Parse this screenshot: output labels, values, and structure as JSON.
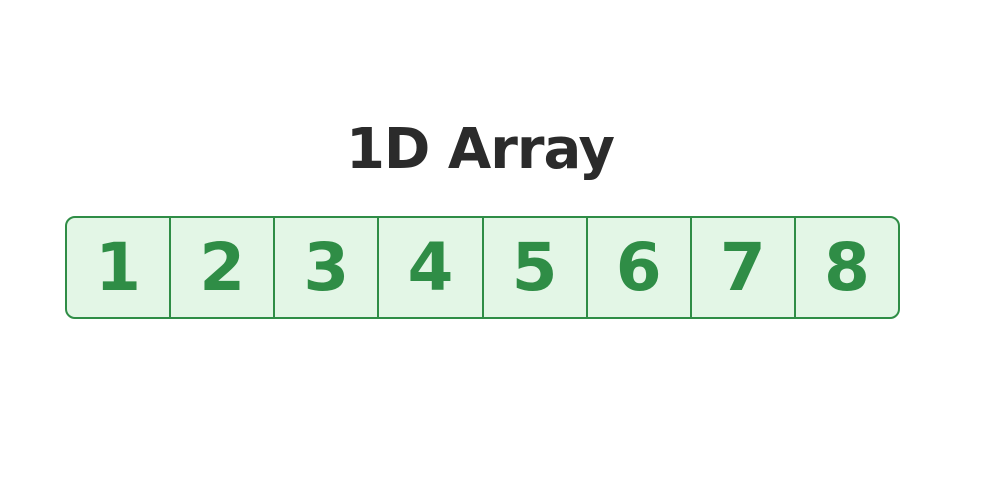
{
  "title": "1D Array",
  "array": {
    "cells": [
      "1",
      "2",
      "3",
      "4",
      "5",
      "6",
      "7",
      "8"
    ]
  },
  "colors": {
    "title_text": "#2b2b2b",
    "cell_text": "#2f8d46",
    "cell_border": "#2f8d46",
    "cell_fill": "#e3f6e6"
  }
}
